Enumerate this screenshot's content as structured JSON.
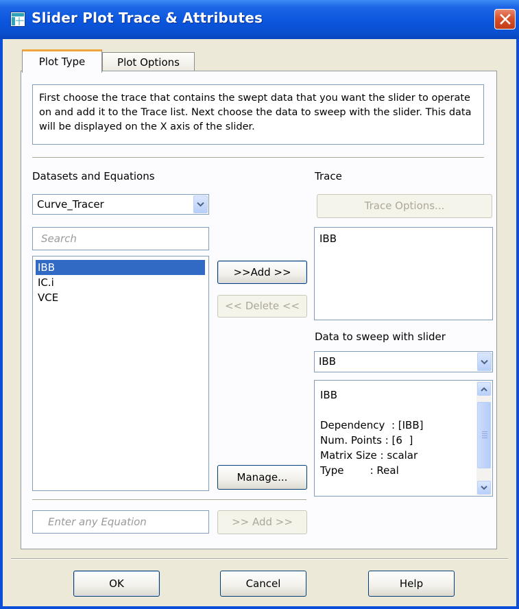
{
  "window": {
    "title": "Slider Plot Trace & Attributes"
  },
  "tabs": [
    {
      "label": "Plot Type",
      "active": true
    },
    {
      "label": "Plot Options",
      "active": false
    }
  ],
  "description": "First choose the trace that contains the swept data that you want the slider to operate on and add it to the Trace list. Next choose the data to sweep with the slider. This data will be displayed on the X axis of the slider.",
  "datasets": {
    "label": "Datasets and Equations",
    "selected": "Curve_Tracer",
    "search_placeholder": "Search",
    "items": [
      {
        "label": "IBB",
        "selected": true
      },
      {
        "label": "IC.i",
        "selected": false
      },
      {
        "label": "VCE",
        "selected": false
      }
    ]
  },
  "buttons": {
    "add": ">>Add >>",
    "delete": "<< Delete <<",
    "manage": "Manage...",
    "equation_add": ">> Add >>",
    "trace_options": "Trace Options...",
    "ok": "OK",
    "cancel": "Cancel",
    "help": "Help"
  },
  "equation": {
    "placeholder": "Enter any Equation"
  },
  "trace": {
    "label": "Trace",
    "items": [
      "IBB"
    ]
  },
  "sweep": {
    "label": "Data to sweep with slider",
    "selected": "IBB",
    "info": {
      "name": "IBB",
      "dependency": "Dependency  : [IBB]",
      "num_points": "Num. Points : [6  ]",
      "matrix_size": "Matrix Size : scalar",
      "type": "Type        : Real"
    }
  },
  "colors": {
    "titlebar": "#0a55dc",
    "dialog_face": "#ece9d8",
    "selection": "#316ac5",
    "close_button": "#d9502a",
    "active_tab_accent": "#f0a53a"
  }
}
